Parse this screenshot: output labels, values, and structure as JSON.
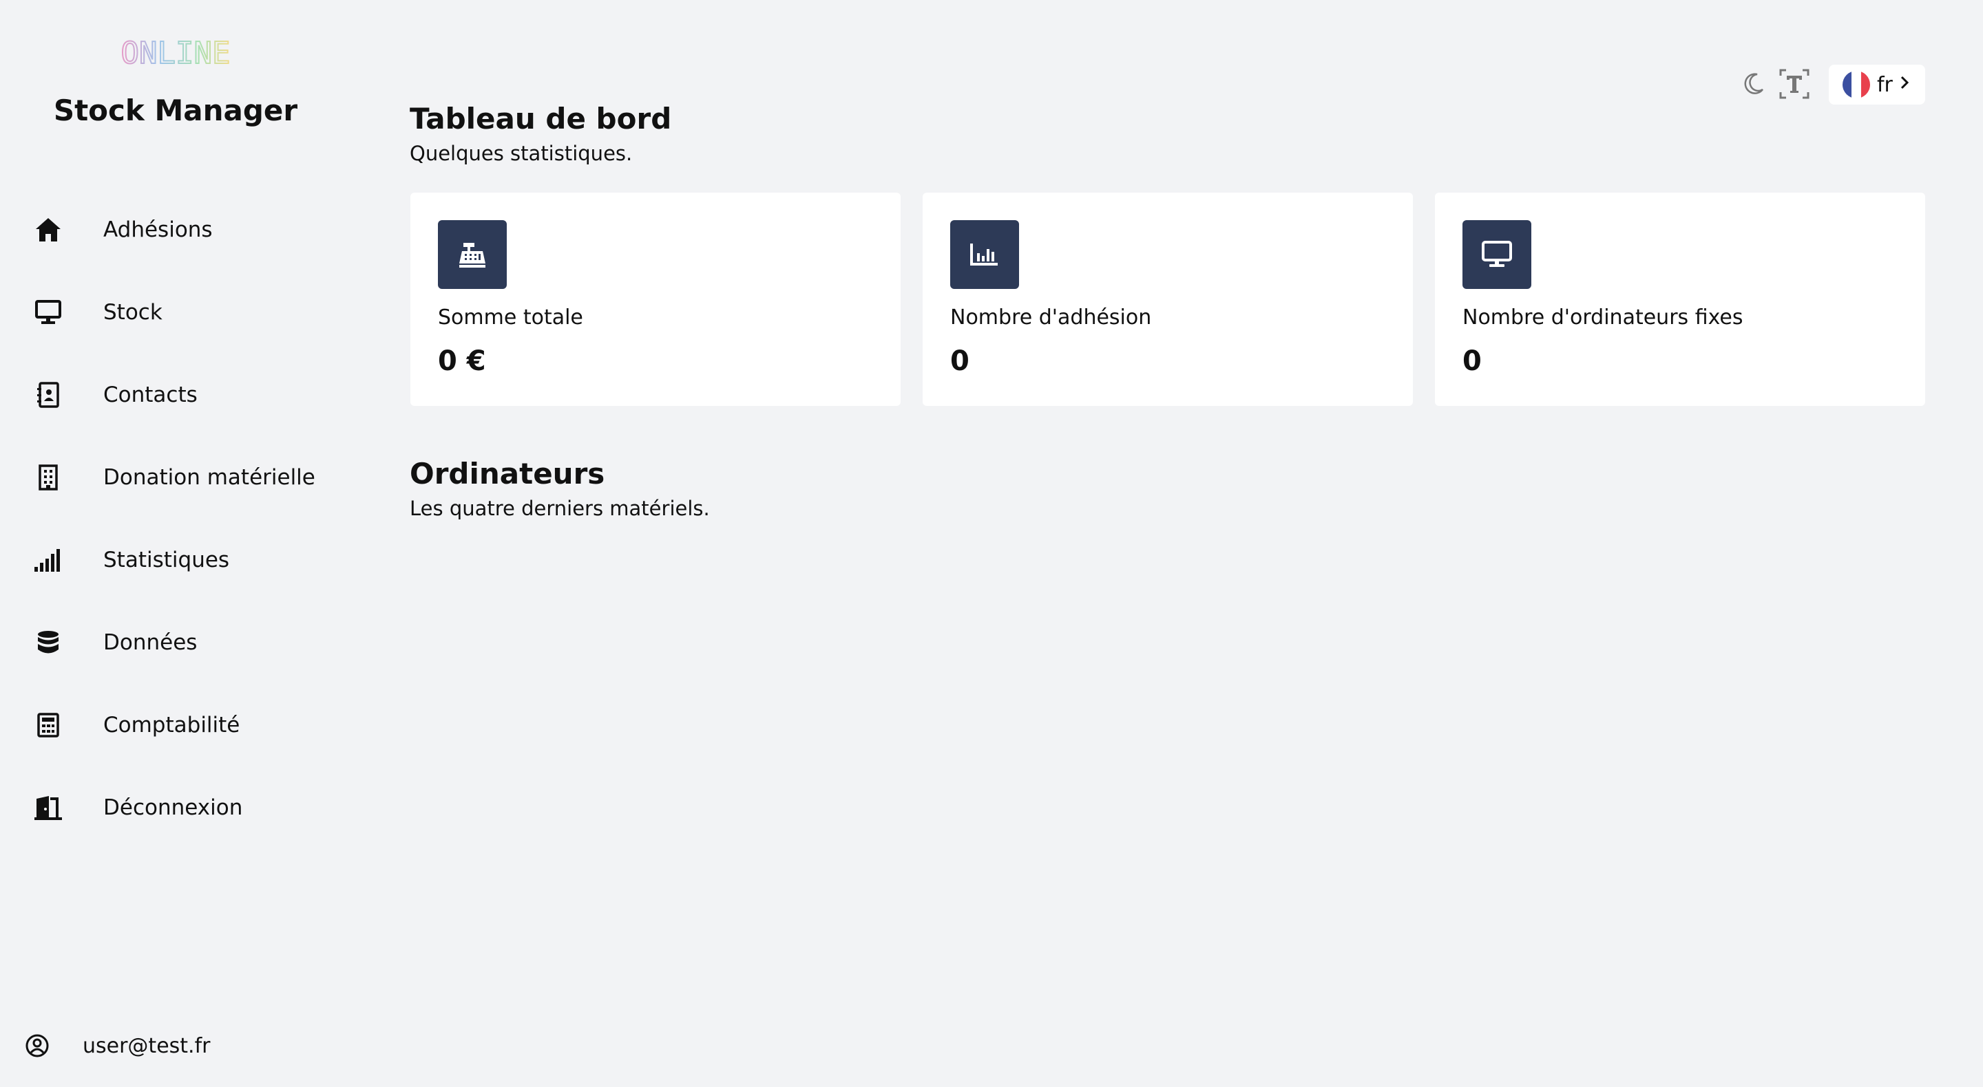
{
  "app": {
    "logo_text": "ONLINE",
    "title": "Stock Manager"
  },
  "sidebar": {
    "items": [
      {
        "label": "Adhésions",
        "icon": "home-icon"
      },
      {
        "label": "Stock",
        "icon": "monitor-icon"
      },
      {
        "label": "Contacts",
        "icon": "contact-book-icon"
      },
      {
        "label": "Donation matérielle",
        "icon": "building-icon"
      },
      {
        "label": "Statistiques",
        "icon": "signal-bars-icon"
      },
      {
        "label": "Données",
        "icon": "database-icon"
      },
      {
        "label": "Comptabilité",
        "icon": "calculator-icon"
      },
      {
        "label": "Déconnexion",
        "icon": "door-exit-icon"
      }
    ],
    "user": {
      "label": "user@test.fr",
      "icon": "user-circle-icon"
    }
  },
  "header": {
    "theme_icon": "moon-icon",
    "text_size_icon": "text-size-icon",
    "language": {
      "label": "fr",
      "flag": "france-flag-icon"
    }
  },
  "dashboard": {
    "title": "Tableau de bord",
    "subtitle": "Quelques statistiques.",
    "cards": [
      {
        "label": "Somme totale",
        "value": "0 €",
        "icon": "cash-register-icon"
      },
      {
        "label": "Nombre d'adhésion",
        "value": "0",
        "icon": "bar-chart-icon"
      },
      {
        "label": "Nombre d'ordinateurs fixes",
        "value": "0",
        "icon": "desktop-icon"
      }
    ]
  },
  "computers": {
    "title": "Ordinateurs",
    "subtitle": "Les quatre derniers matériels."
  },
  "colors": {
    "background": "#f2f3f5",
    "card": "#ffffff",
    "icon_tile": "#2d3a57",
    "flag_blue": "#3b4fa0",
    "flag_red": "#e8414d"
  }
}
